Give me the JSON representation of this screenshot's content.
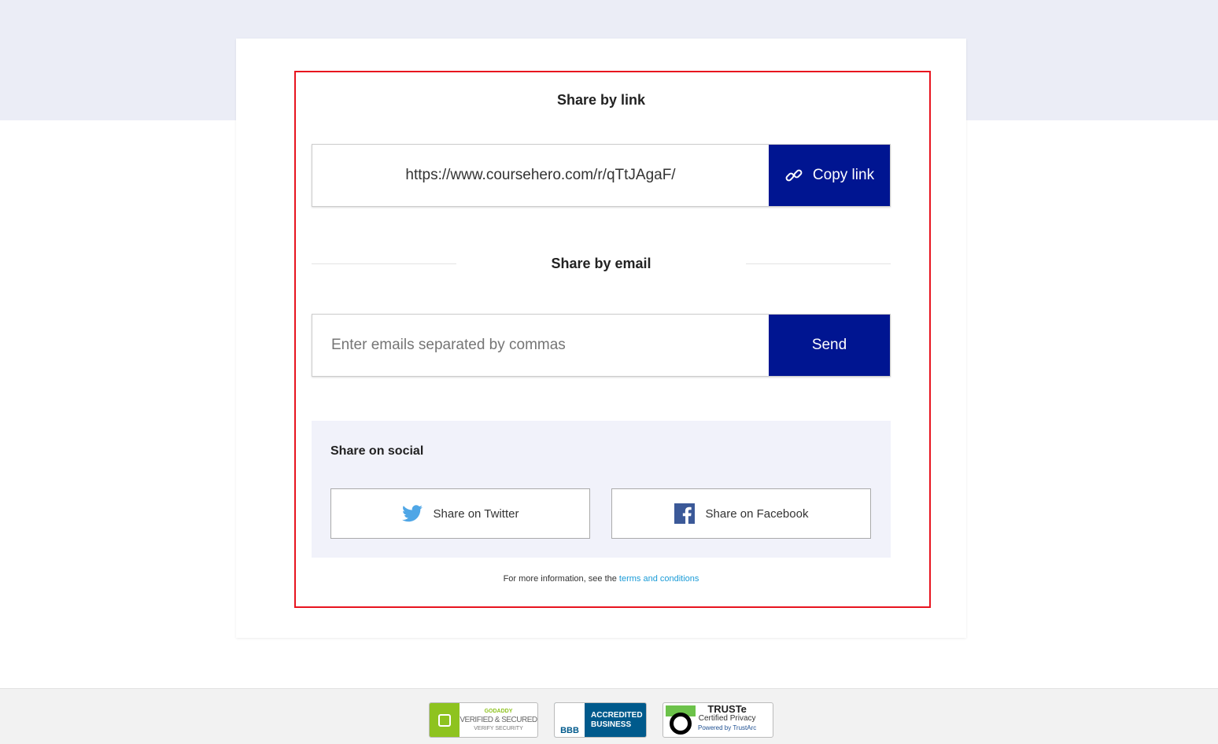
{
  "share_link": {
    "title": "Share by link",
    "url": "https://www.coursehero.com/r/qTtJAgaF/",
    "copy_label": "Copy link"
  },
  "share_email": {
    "title": "Share by email",
    "placeholder": "Enter emails separated by commas",
    "send_label": "Send"
  },
  "social": {
    "title": "Share on social",
    "twitter_label": "Share on Twitter",
    "facebook_label": "Share on Facebook"
  },
  "info": {
    "text": "For more information, see the ",
    "link": "terms and conditions"
  },
  "badges": {
    "godaddy": {
      "brand": "GODADDY",
      "line1": "VERIFIED & SECURED",
      "line2": "VERIFY SECURITY"
    },
    "bbb": {
      "brand": "BBB",
      "line1": "ACCREDITED",
      "line2": "BUSINESS"
    },
    "truste": {
      "brand": "TRUSTe",
      "line1": "Certified Privacy",
      "line2": "Powered by TrustArc"
    }
  },
  "colors": {
    "accent": "#001591",
    "highlight": "#e8141f",
    "link": "#1a9bd7",
    "twitter": "#1da1f2",
    "facebook": "#3b5998"
  }
}
